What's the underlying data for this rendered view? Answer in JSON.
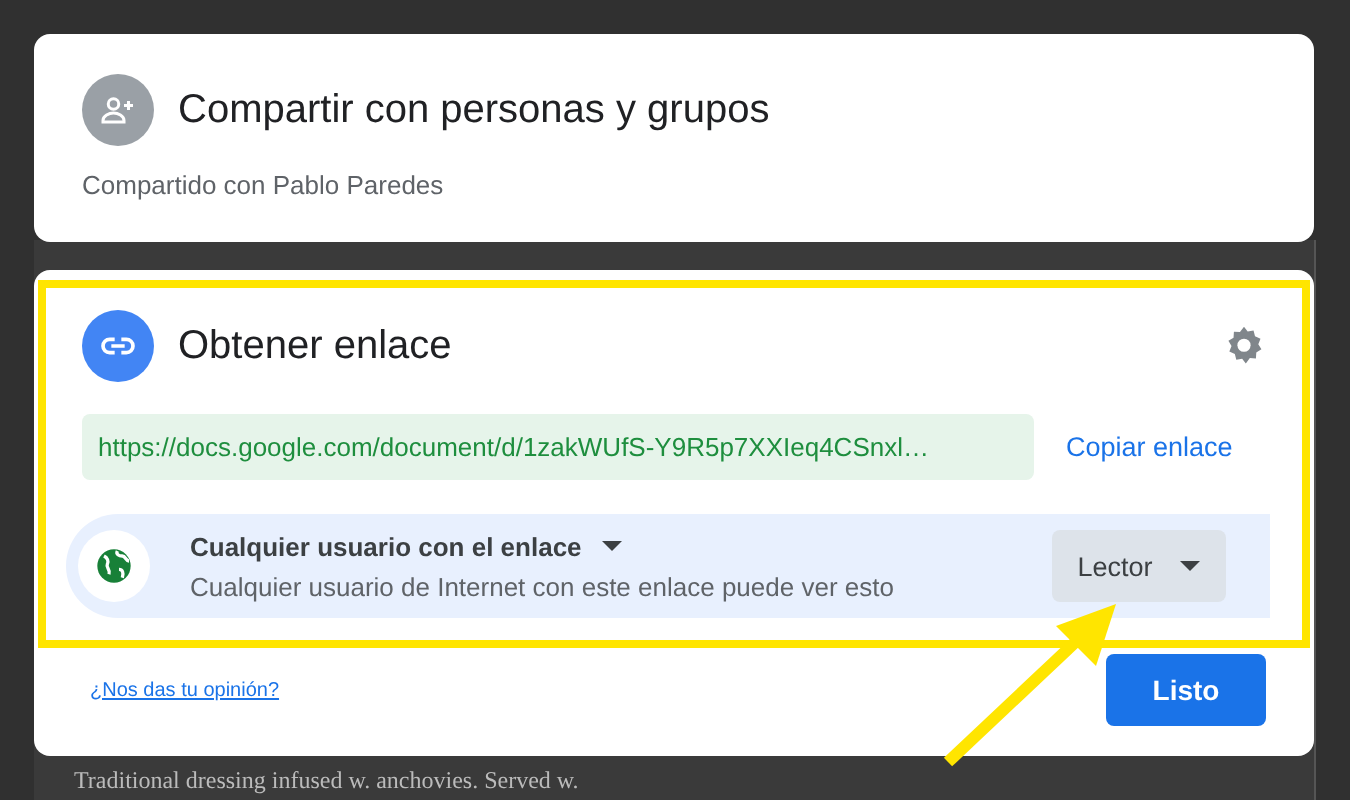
{
  "background_document": {
    "line": "Traditional dressing infused w. anchovies. Served w."
  },
  "share_people": {
    "title": "Compartir con personas y grupos",
    "shared_with": "Compartido con Pablo Paredes"
  },
  "get_link": {
    "title": "Obtener enlace",
    "url": "https://docs.google.com/document/d/1zakWUfS-Y9R5p7XXIeq4CSnxl…",
    "copy_button": "Copiar enlace",
    "access": {
      "scope": "Cualquier usuario con el enlace",
      "description": "Cualquier usuario de Internet con este enlace puede ver esto",
      "role": "Lector"
    }
  },
  "footer": {
    "feedback_link": "¿Nos das tu opinión?",
    "done_button": "Listo"
  }
}
